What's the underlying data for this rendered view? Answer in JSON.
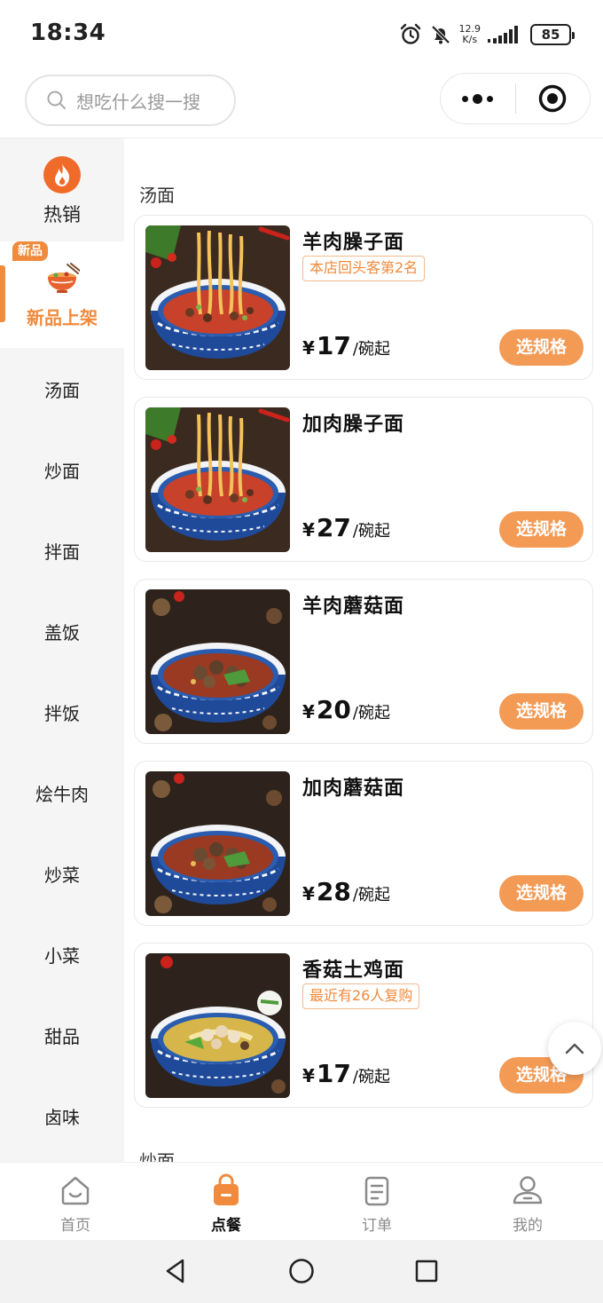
{
  "status_bar": {
    "time": "18:34",
    "net_speed_value": "12.9",
    "net_speed_unit": "K/s",
    "battery": "85"
  },
  "search": {
    "placeholder": "想吃什么搜一搜"
  },
  "sidebar": {
    "hot": {
      "label": "热销"
    },
    "new": {
      "tag": "新品",
      "label": "新品上架"
    },
    "items": [
      "汤面",
      "炒面",
      "拌面",
      "盖饭",
      "拌饭",
      "烩牛肉",
      "炒菜",
      "小菜",
      "甜品",
      "卤味"
    ]
  },
  "sections": [
    {
      "title": "汤面",
      "dishes": [
        {
          "name": "羊肉臊子面",
          "badge": "本店回头客第2名",
          "currency": "¥",
          "price": "17",
          "unit": "/碗起",
          "button": "选规格",
          "image": "red-broth-noodles"
        },
        {
          "name": "加肉臊子面",
          "badge": "",
          "currency": "¥",
          "price": "27",
          "unit": "/碗起",
          "button": "选规格",
          "image": "red-broth-noodles"
        },
        {
          "name": "羊肉蘑菇面",
          "badge": "",
          "currency": "¥",
          "price": "20",
          "unit": "/碗起",
          "button": "选规格",
          "image": "mushroom-noodles"
        },
        {
          "name": "加肉蘑菇面",
          "badge": "",
          "currency": "¥",
          "price": "28",
          "unit": "/碗起",
          "button": "选规格",
          "image": "mushroom-noodles"
        },
        {
          "name": "香菇土鸡面",
          "badge": "最近有26人复购",
          "currency": "¥",
          "price": "17",
          "unit": "/碗起",
          "button": "选规格",
          "image": "chicken-noodles"
        }
      ]
    },
    {
      "title": "炒面"
    }
  ],
  "tabbar": [
    {
      "label": "首页",
      "icon": "home-icon",
      "active": false
    },
    {
      "label": "点餐",
      "icon": "bag-icon",
      "active": true
    },
    {
      "label": "订单",
      "icon": "order-icon",
      "active": false
    },
    {
      "label": "我的",
      "icon": "user-icon",
      "active": false
    }
  ],
  "colors": {
    "accent": "#f08a3c",
    "button": "#f39a55",
    "sidebar_bg": "#f5f5f5"
  }
}
